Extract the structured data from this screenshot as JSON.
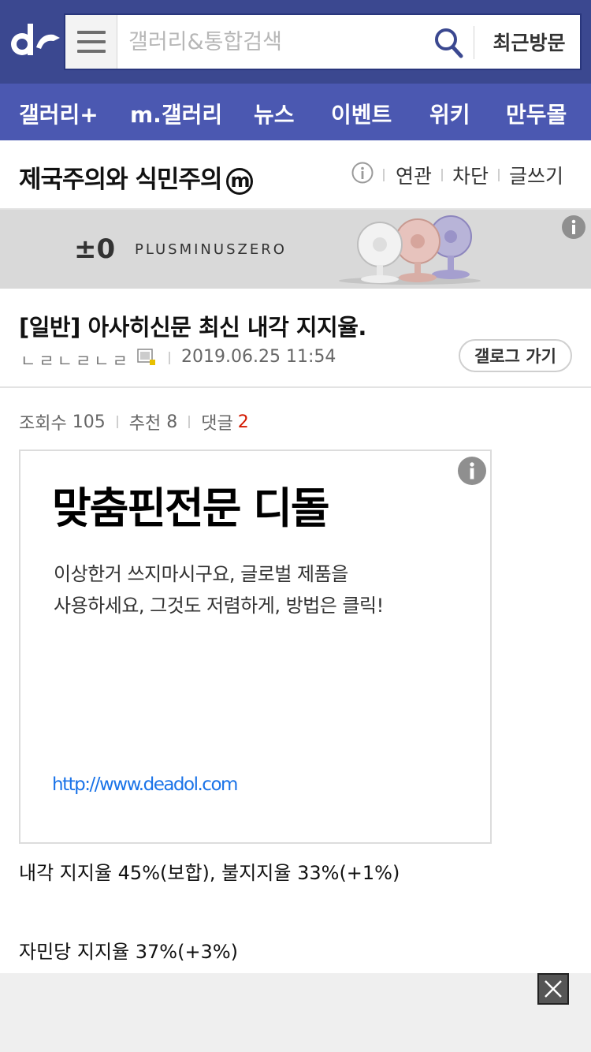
{
  "header": {
    "logo_icon": "dc-logo-icon",
    "menu_icon": "hamburger-menu-icon",
    "search_placeholder": "갤러리&통합검색",
    "search_icon": "search-icon",
    "recent_label": "최근방문"
  },
  "nav": {
    "items": [
      "갤러리+",
      "m.갤러리",
      "뉴스",
      "이벤트",
      "위키",
      "만두몰"
    ]
  },
  "gallery": {
    "title": "제국주의와 식민주의",
    "minor_badge": "m",
    "links": [
      "연관",
      "차단",
      "글쓰기"
    ]
  },
  "banner": {
    "mark": "±0",
    "brand": "PLUSMINUSZERO"
  },
  "post": {
    "title": "[일반] 아사히신문 최신 내각 지지율.",
    "writer": "ㄴㄹㄴㄹㄴㄹ",
    "date": "2019.06.25 11:54",
    "gallog_label": "갤로그 가기",
    "views_label": "조회수",
    "views": "105",
    "recommend_label": "추천",
    "recommend": "8",
    "comments_label": "댓글",
    "comments": "2"
  },
  "ad": {
    "headline": "맞춤핀전문 디돌",
    "desc_line1": "이상한거 쓰지마시구요, 글로벌 제품을",
    "desc_line2": "사용하세요, 그것도 저렴하게, 방법은 클릭!",
    "url": "http://www.deadol.com"
  },
  "content": {
    "line1": "내각 지지율 45%(보합), 불지지율 33%(+1%)",
    "line2": "자민당 지지율 37%(+3%)"
  },
  "colors": {
    "header_bg": "#3b4890",
    "nav_bg": "#4b58b1",
    "comment_count": "#d31900",
    "ad_url": "#1a73e8"
  }
}
